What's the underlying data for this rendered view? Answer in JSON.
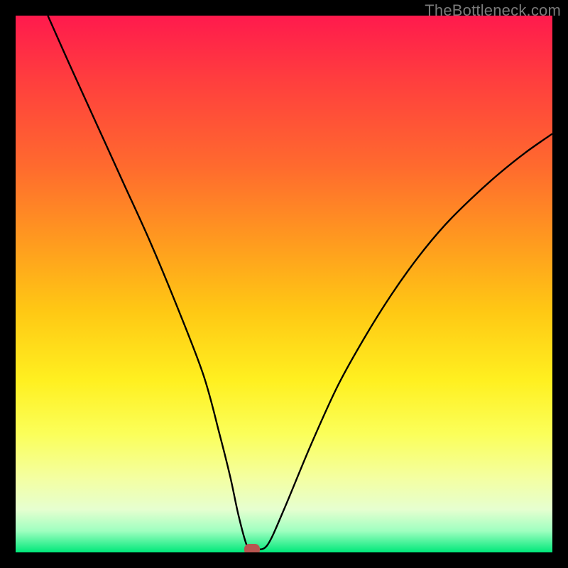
{
  "watermark": "TheBottleneck.com",
  "chart_data": {
    "type": "line",
    "title": "",
    "xlabel": "",
    "ylabel": "",
    "xlim": [
      0,
      100
    ],
    "ylim": [
      0,
      100
    ],
    "grid": false,
    "series": [
      {
        "name": "curve",
        "x": [
          6,
          10,
          15,
          20,
          25,
          30,
          35,
          38,
          40,
          41.5,
          43,
          44,
          45,
          47,
          50,
          55,
          60,
          65,
          70,
          75,
          80,
          85,
          90,
          95,
          100
        ],
        "y": [
          100,
          91,
          80,
          69,
          58,
          46,
          33,
          22,
          14,
          7,
          1.5,
          0.5,
          0.5,
          1.5,
          8,
          20,
          31,
          40,
          48,
          55,
          61,
          66,
          70.5,
          74.5,
          78
        ]
      }
    ],
    "marker": {
      "x": 44,
      "y": 0.5
    },
    "background_gradient": {
      "top": "#ff1a4d",
      "bottom": "#00e87a"
    }
  }
}
